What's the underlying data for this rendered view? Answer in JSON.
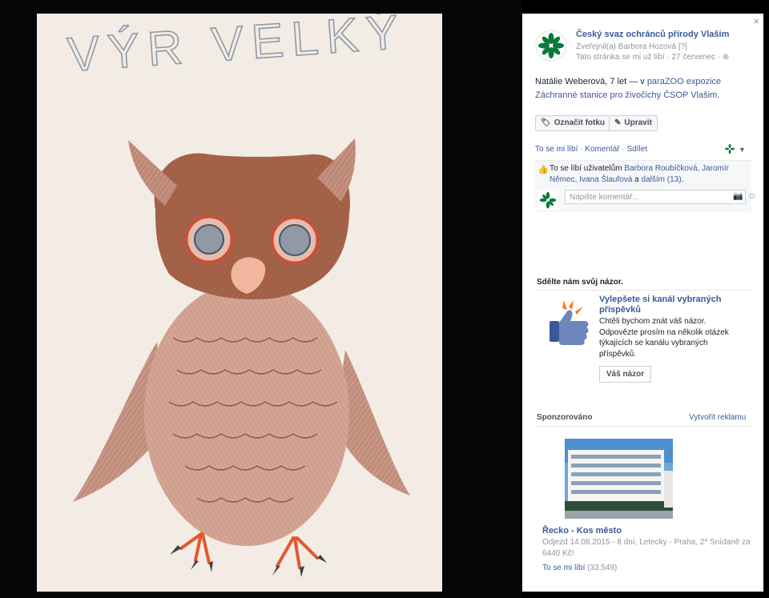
{
  "close_label": "×",
  "photo": {
    "title_text": "VÝR VELKÝ",
    "description": "Children's colored pencil drawing of an owl"
  },
  "page": {
    "name": "Český svaz ochránců přírody Vlašim",
    "posted_by": "Zveřejnil(a) Barbora Hozová [?]",
    "unliked": "Tato stránka se mi už líbí",
    "date": "27 červenec",
    "globe": "⊕"
  },
  "caption": {
    "prefix": "Natálie Weberová, 7 let — v ",
    "place": "paraZOO expozice Záchranné stanice pro živočichy ČSOP Vlašim",
    "suffix": "."
  },
  "buttons": {
    "tag_icon": "🏷",
    "tag": "Označit fotku",
    "edit_icon": "✎",
    "edit": "Upravit"
  },
  "actions": {
    "like": "To se mi líbí",
    "comment": "Komentář",
    "share": "Sdílet",
    "dot": "·",
    "caret": "▼"
  },
  "likes": {
    "thumb": "👍",
    "prefix": "To se líbí uživatelům ",
    "names": "Barbora Roubíčková, Jaromír Němec, Ivana Šlaufová",
    "middle": " a ",
    "others": "dalším (13)",
    "suffix": "."
  },
  "comment": {
    "placeholder": "Napište komentář...",
    "camera": "📷",
    "emoji": "☺"
  },
  "feedback": {
    "section_title": "Sdělte nám svůj názor.",
    "title": "Vylepšete si kanál vybraných příspěvků",
    "body": "Chtěli bychom znát váš názor. Odpovězte prosím na několik otázek týkajících se kanálu vybraných příspěvků.",
    "button": "Váš názor"
  },
  "sponsored": {
    "label": "Sponzorováno",
    "create_ad": "Vytvořit reklamu",
    "ad_title": "Řecko - Kos město",
    "ad_body": "Odjezd 14.08.2015 - 8 dní, Letecky - Praha, 2* Snídaně za 6440 Kč!",
    "ad_likes": "To se mi líbí",
    "ad_likes_count": "(33.549)"
  },
  "colors": {
    "link": "#3b5998",
    "owl_brown": "#9a5a3a",
    "logo_green": "#0a7a3a"
  }
}
